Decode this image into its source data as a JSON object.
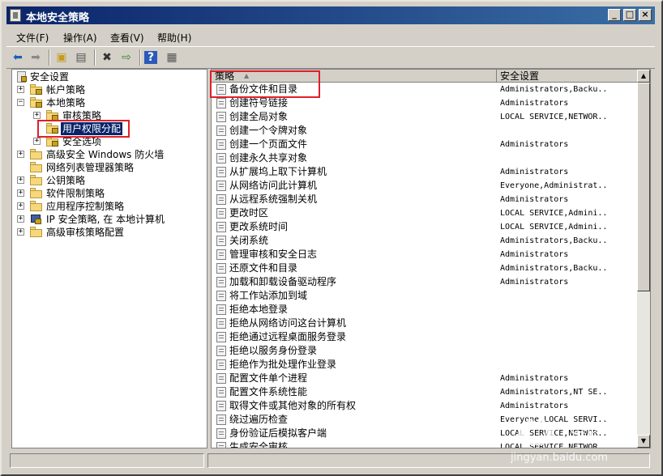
{
  "window": {
    "title": "本地安全策略",
    "controls": {
      "minimize": "_",
      "maximize": "□",
      "close": "×"
    }
  },
  "menubar": [
    {
      "label": "文件(F)"
    },
    {
      "label": "操作(A)"
    },
    {
      "label": "查看(V)"
    },
    {
      "label": "帮助(H)"
    }
  ],
  "toolbar": {
    "icons": [
      "back-icon",
      "forward-icon",
      "up-folder-icon",
      "show-hide-tree-icon",
      "delete-icon",
      "export-icon",
      "help-icon",
      "properties-icon"
    ]
  },
  "tree": {
    "root": "安全设置",
    "items": [
      {
        "label": "帐户策略",
        "expander": "+"
      },
      {
        "label": "本地策略",
        "expander": "−"
      },
      {
        "label": "审核策略",
        "expander": "+"
      },
      {
        "label": "用户权限分配",
        "expander": ""
      },
      {
        "label": "安全选项",
        "expander": "+"
      },
      {
        "label": "高级安全 Windows 防火墙",
        "expander": "+"
      },
      {
        "label": "网络列表管理器策略",
        "expander": ""
      },
      {
        "label": "公钥策略",
        "expander": "+"
      },
      {
        "label": "软件限制策略",
        "expander": "+"
      },
      {
        "label": "应用程序控制策略",
        "expander": "+"
      },
      {
        "label": "IP 安全策略, 在 本地计算机",
        "expander": "+"
      },
      {
        "label": "高级审核策略配置",
        "expander": "+"
      }
    ]
  },
  "list": {
    "columns": {
      "policy": "策略",
      "setting": "安全设置"
    },
    "rows": [
      {
        "name": "备份文件和目录",
        "setting": "Administrators,Backu..."
      },
      {
        "name": "创建符号链接",
        "setting": "Administrators"
      },
      {
        "name": "创建全局对象",
        "setting": "LOCAL SERVICE,NETWOR..."
      },
      {
        "name": "创建一个令牌对象",
        "setting": ""
      },
      {
        "name": "创建一个页面文件",
        "setting": "Administrators"
      },
      {
        "name": "创建永久共享对象",
        "setting": ""
      },
      {
        "name": "从扩展坞上取下计算机",
        "setting": "Administrators"
      },
      {
        "name": "从网络访问此计算机",
        "setting": "Everyone,Administrat..."
      },
      {
        "name": "从远程系统强制关机",
        "setting": "Administrators"
      },
      {
        "name": "更改时区",
        "setting": "LOCAL SERVICE,Admini..."
      },
      {
        "name": "更改系统时间",
        "setting": "LOCAL SERVICE,Admini..."
      },
      {
        "name": "关闭系统",
        "setting": "Administrators,Backu..."
      },
      {
        "name": "管理审核和安全日志",
        "setting": "Administrators"
      },
      {
        "name": "还原文件和目录",
        "setting": "Administrators,Backu..."
      },
      {
        "name": "加载和卸载设备驱动程序",
        "setting": "Administrators"
      },
      {
        "name": "将工作站添加到域",
        "setting": ""
      },
      {
        "name": "拒绝本地登录",
        "setting": ""
      },
      {
        "name": "拒绝从网络访问这台计算机",
        "setting": ""
      },
      {
        "name": "拒绝通过远程桌面服务登录",
        "setting": ""
      },
      {
        "name": "拒绝以服务身份登录",
        "setting": ""
      },
      {
        "name": "拒绝作为批处理作业登录",
        "setting": ""
      },
      {
        "name": "配置文件单个进程",
        "setting": "Administrators"
      },
      {
        "name": "配置文件系统性能",
        "setting": "Administrators,NT SE..."
      },
      {
        "name": "取得文件或其他对象的所有权",
        "setting": "Administrators"
      },
      {
        "name": "绕过遍历检查",
        "setting": "Everyone,LOCAL SERVI..."
      },
      {
        "name": "身份验证后模拟客户端",
        "setting": "LOCAL SERVICE,NETWOR..."
      },
      {
        "name": "生成安全审核",
        "setting": "LOCAL SERVICE,NETWOR..."
      }
    ]
  },
  "watermark": {
    "text": "jingyan.baidu.com",
    "logo": "经验"
  },
  "colors": {
    "titlebar": "#0a246a",
    "highlight_box": "#e0202a",
    "selected": "#0a246a"
  }
}
